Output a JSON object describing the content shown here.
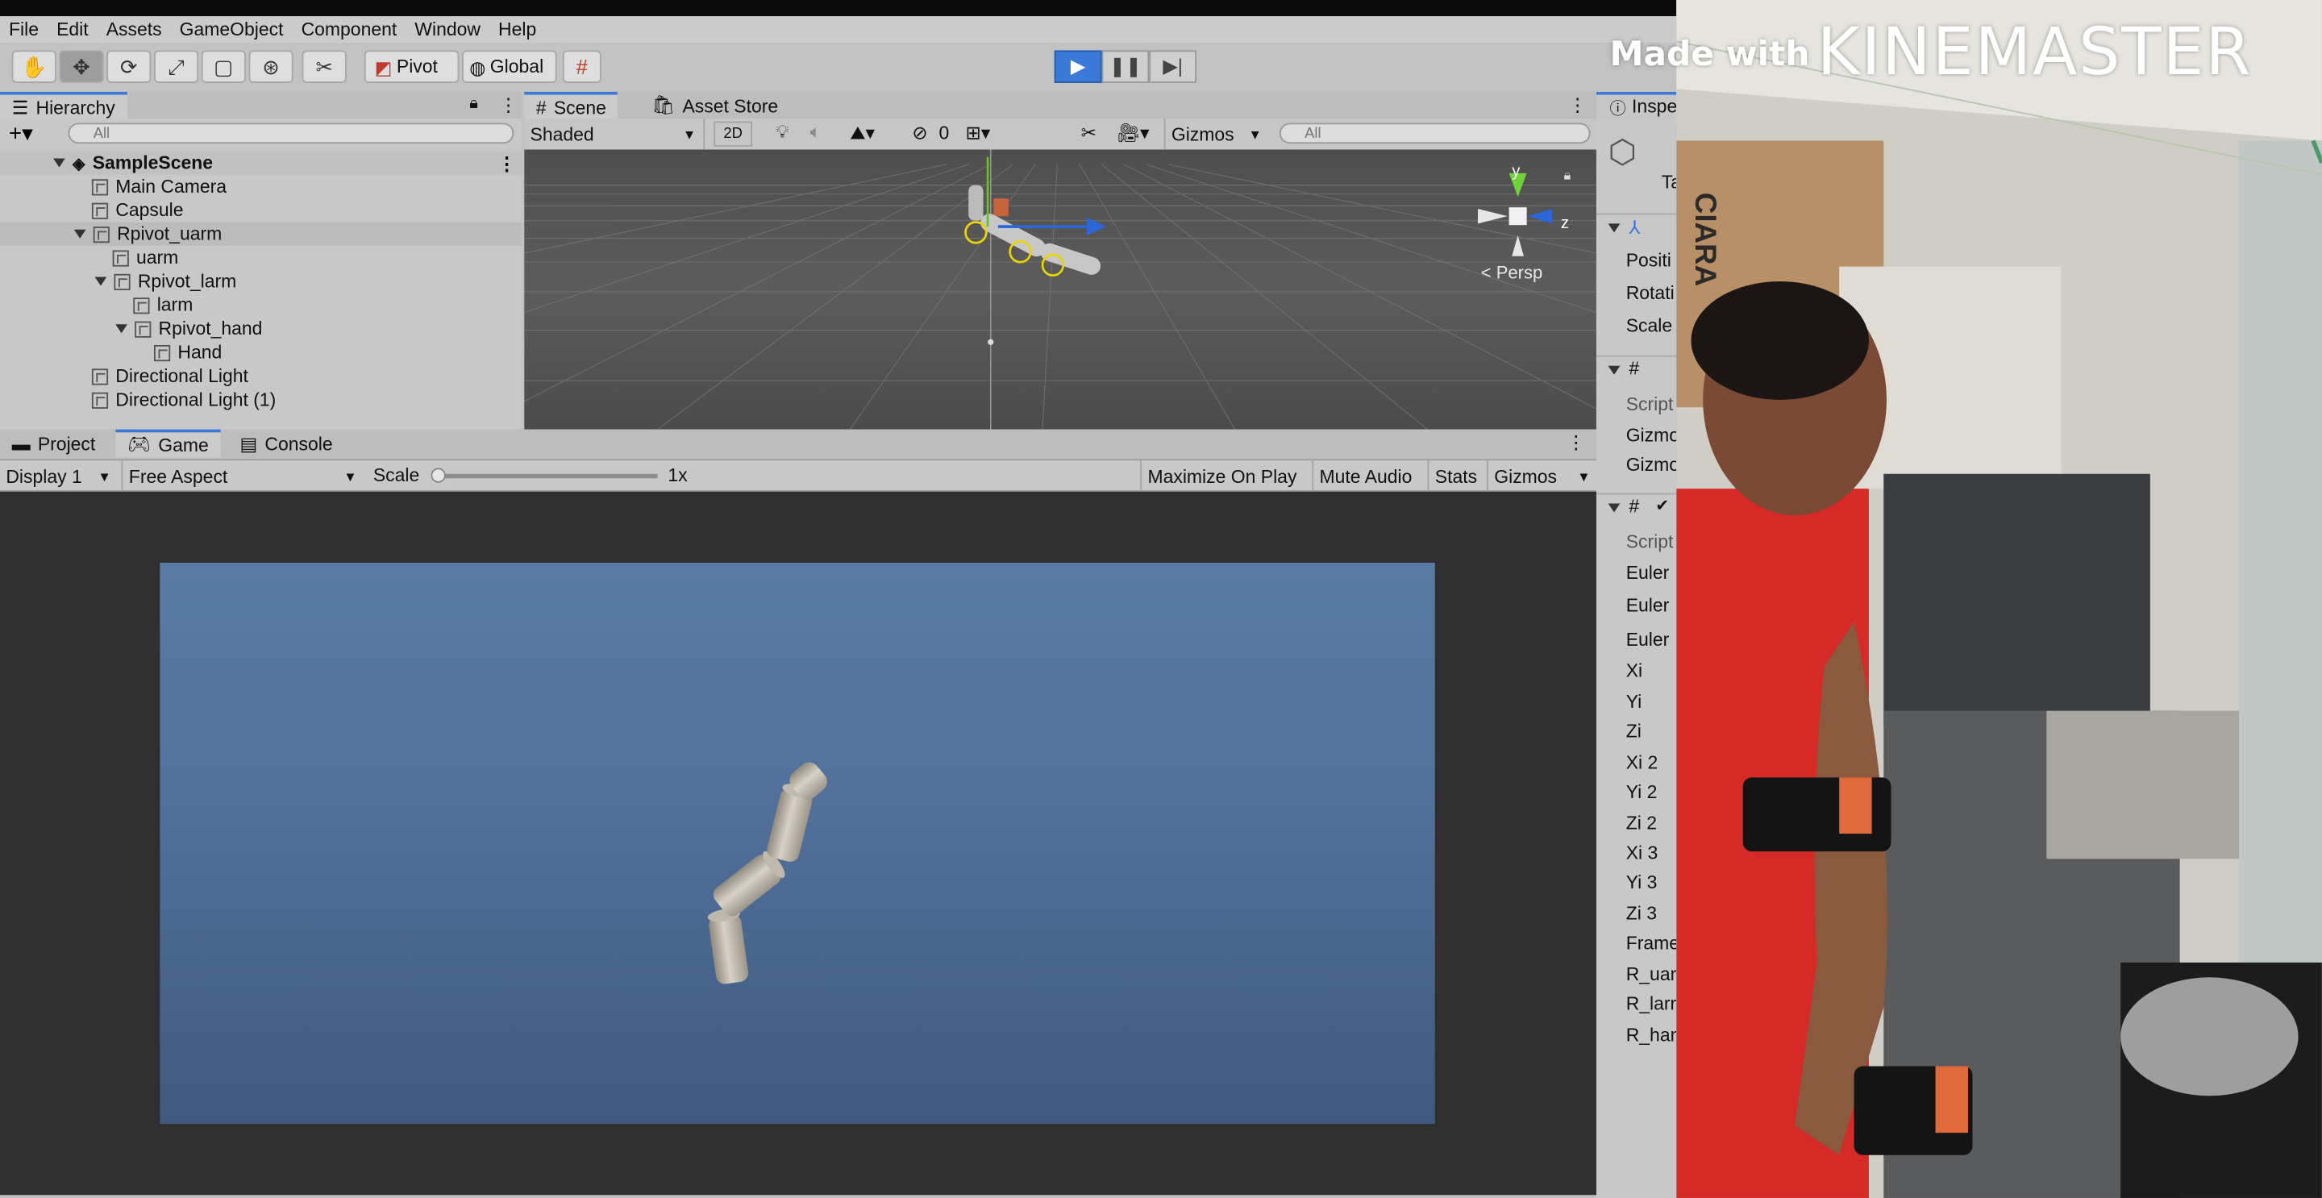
{
  "menu": [
    "File",
    "Edit",
    "Assets",
    "GameObject",
    "Component",
    "Window",
    "Help"
  ],
  "toolbar": {
    "pivot_label": "Pivot",
    "global_label": "Global"
  },
  "hierarchy": {
    "title": "Hierarchy",
    "search_placeholder": "All",
    "scene_name": "SampleScene",
    "items": [
      "Main Camera",
      "Capsule",
      "Rpivot_uarm",
      "uarm",
      "Rpivot_larm",
      "larm",
      "Rpivot_hand",
      "Hand",
      "Directional Light",
      "Directional Light (1)"
    ]
  },
  "scene": {
    "tabs": [
      "Scene",
      "Asset Store"
    ],
    "shading": "Shaded",
    "mode_2d": "2D",
    "hidden_count": "0",
    "gizmos_label": "Gizmos",
    "search_placeholder": "All",
    "persp_label": "< Persp",
    "axis_y": "y",
    "axis_z": "z"
  },
  "bottom_tabs": [
    "Project",
    "Game",
    "Console"
  ],
  "game": {
    "display": "Display 1",
    "aspect": "Free Aspect",
    "scale_label": "Scale",
    "scale_value": "1x",
    "maximize": "Maximize On Play",
    "mute": "Mute Audio",
    "stats": "Stats",
    "gizmos": "Gizmos"
  },
  "inspector": {
    "title": "Inspe",
    "tag_fragment": "Ta",
    "transform_rows": [
      "Positi",
      "Rotati",
      "Scale"
    ],
    "script_rows_a": [
      "Script",
      "Gizmo",
      "Gizmo"
    ],
    "script_rows_b": [
      "Script",
      "Euler",
      "Euler",
      "Euler",
      "Xi",
      "Yi",
      "Zi",
      "Xi 2",
      "Yi 2",
      "Zi 2",
      "Xi 3",
      "Yi 3",
      "Zi 3",
      "Frame",
      "R_uar",
      "R_larr",
      "R_han"
    ]
  },
  "watermark": {
    "prefix": "Made with",
    "brand": "KINEMASTER"
  },
  "video_box_text": "CIARA",
  "colors": {
    "accent": "#3a79d8",
    "game_bg": "#52719c",
    "editor_bg": "#c2c2c2"
  }
}
